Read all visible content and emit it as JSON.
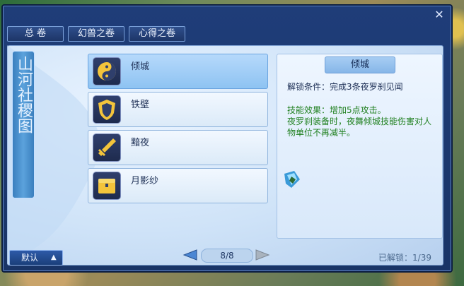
{
  "window": {
    "close_glyph": "✕",
    "tabs": [
      {
        "label": "总 卷"
      },
      {
        "label": "幻兽之卷"
      },
      {
        "label": "心得之卷"
      }
    ],
    "scroll_text": "山河社稷图"
  },
  "cards": [
    {
      "label": "倾城",
      "icon": "yin-yang-icon",
      "active": true
    },
    {
      "label": "铁壁",
      "icon": "shield-icon",
      "active": false
    },
    {
      "label": "黯夜",
      "icon": "sword-icon",
      "active": false
    },
    {
      "label": "月影纱",
      "icon": "chest-icon",
      "active": false
    }
  ],
  "detail": {
    "title": "倾城",
    "unlock_label": "解锁条件：",
    "unlock_value": "完成3条夜罗刹见闻",
    "effect_label": "技能效果：",
    "effect_value": "增加5点攻击。",
    "effect_desc": "夜罗刹装备时，夜舞倾城技能伤害对人物单位不再减半。"
  },
  "footer": {
    "sort_label": "默认",
    "sort_caret": "▲",
    "page": "8/8",
    "unlocked_label": "已解锁：",
    "unlocked_value": "1/39"
  }
}
